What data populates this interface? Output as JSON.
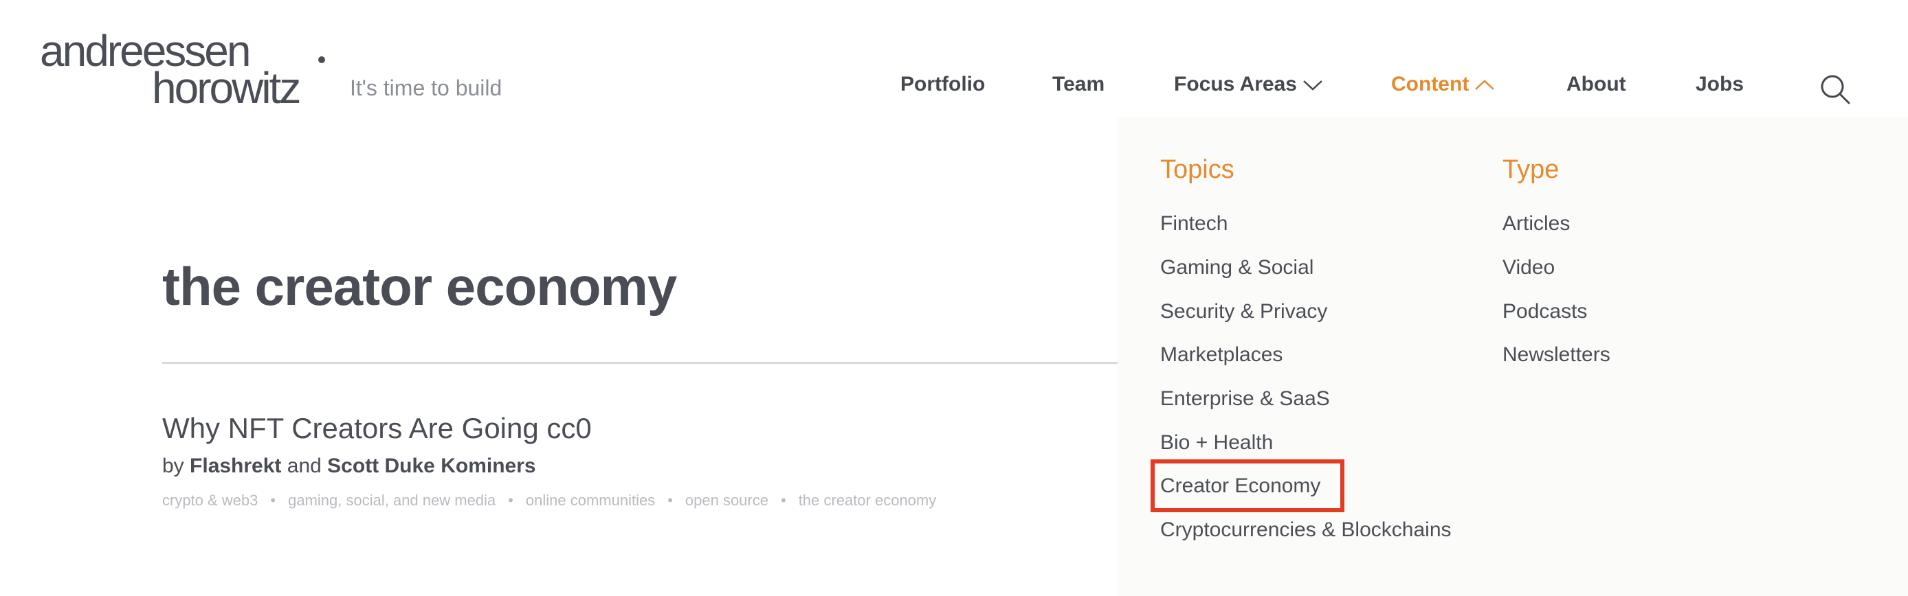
{
  "logo": {
    "line1": "andreessen",
    "line2": "horowitz"
  },
  "tagline": "It's time to build",
  "nav": {
    "portfolio": "Portfolio",
    "team": "Team",
    "focus_areas": "Focus Areas",
    "content": "Content",
    "about": "About",
    "jobs": "Jobs"
  },
  "accent_color": "#e68a2e",
  "dropdown": {
    "topics_heading": "Topics",
    "type_heading": "Type",
    "topics": [
      "Fintech",
      "Gaming & Social",
      "Security & Privacy",
      "Marketplaces",
      "Enterprise & SaaS",
      "Bio + Health",
      "Creator Economy",
      "Cryptocurrencies & Blockchains"
    ],
    "types": [
      "Articles",
      "Video",
      "Podcasts",
      "Newsletters"
    ]
  },
  "page_title": "the creator economy",
  "article": {
    "title": "Why NFT Creators Are Going cc0",
    "by": "by",
    "author1": "Flashrekt",
    "and": "and",
    "author2": "Scott Duke Kominers",
    "tags": [
      "crypto & web3",
      "gaming, social, and new media",
      "online communities",
      "open source",
      "the creator economy"
    ],
    "tag_separator": "•"
  }
}
